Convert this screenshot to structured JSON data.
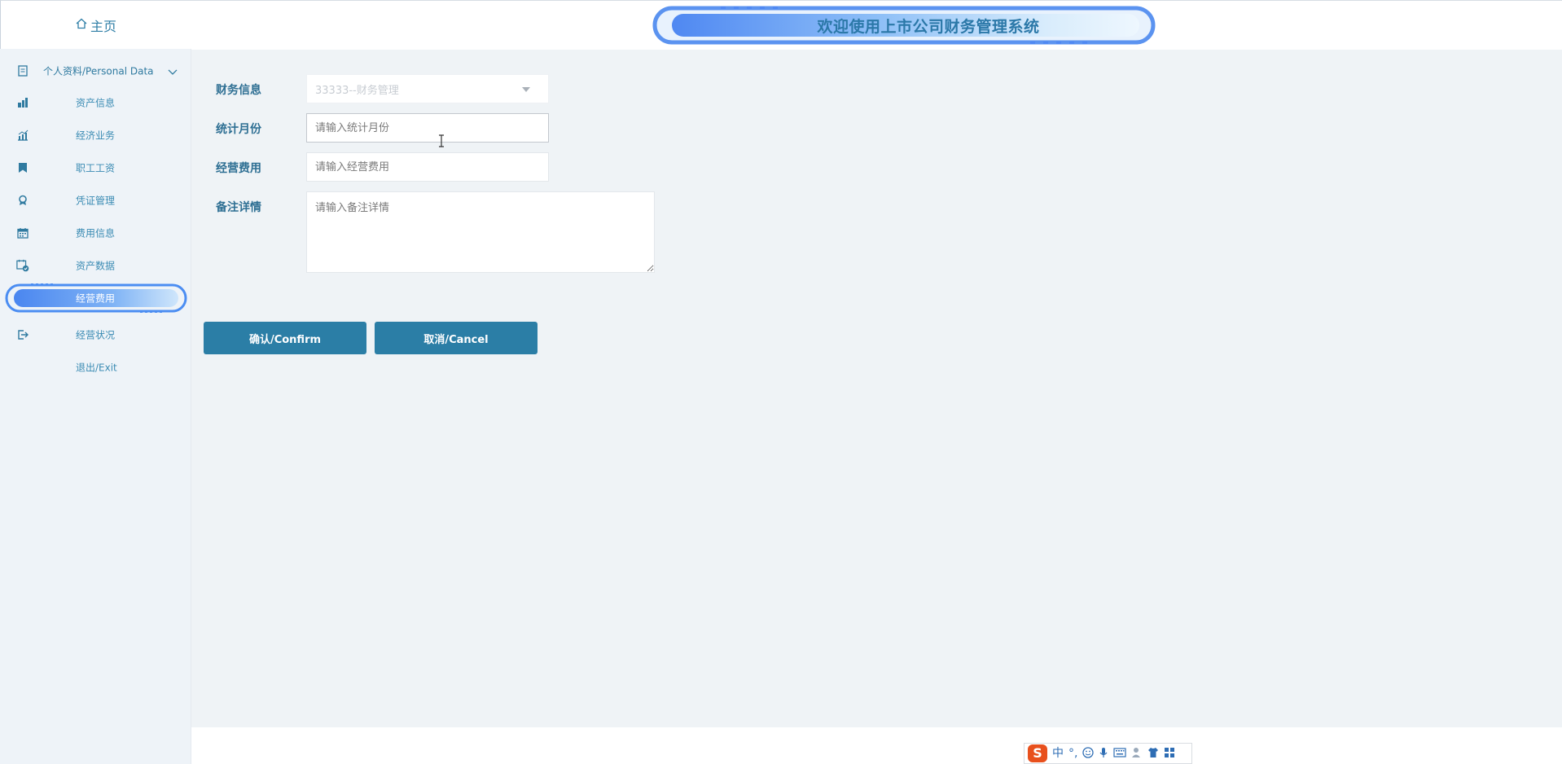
{
  "header": {
    "title": "欢迎使用上市公司财务管理系统"
  },
  "sidebar": {
    "home_label": "主页",
    "items": [
      {
        "label": "个人资料/Personal Data",
        "icon": "document-icon"
      },
      {
        "label": "资产信息",
        "icon": "building-chart-icon"
      },
      {
        "label": "经济业务",
        "icon": "bar-chart-icon"
      },
      {
        "label": "职工工资",
        "icon": "bookmark-icon"
      },
      {
        "label": "凭证管理",
        "icon": "badge-icon"
      },
      {
        "label": "费用信息",
        "icon": "calendar-icon"
      },
      {
        "label": "资产数据",
        "icon": "calendar-check-icon"
      },
      {
        "label": "经营费用",
        "icon": "none",
        "active": true
      },
      {
        "label": "经营状况",
        "icon": "exit-icon"
      },
      {
        "label": "退出/Exit",
        "icon": "none"
      }
    ]
  },
  "form": {
    "finance_info_label": "财务信息",
    "finance_info_value": "33333--财务管理",
    "month_label": "统计月份",
    "month_placeholder": "请输入统计月份",
    "expense_label": "经营费用",
    "expense_placeholder": "请输入经营费用",
    "remark_label": "备注详情",
    "remark_placeholder": "请输入备注详情",
    "confirm_label": "确认/Confirm",
    "cancel_label": "取消/Cancel"
  },
  "ime": {
    "logo": "S",
    "mode": "中",
    "punct": "°,"
  },
  "colors": {
    "accent": "#2b7ea6",
    "sidebar_bg": "#eef3f8",
    "main_bg": "#eff3f6",
    "menu_text": "#3a8bb3"
  }
}
